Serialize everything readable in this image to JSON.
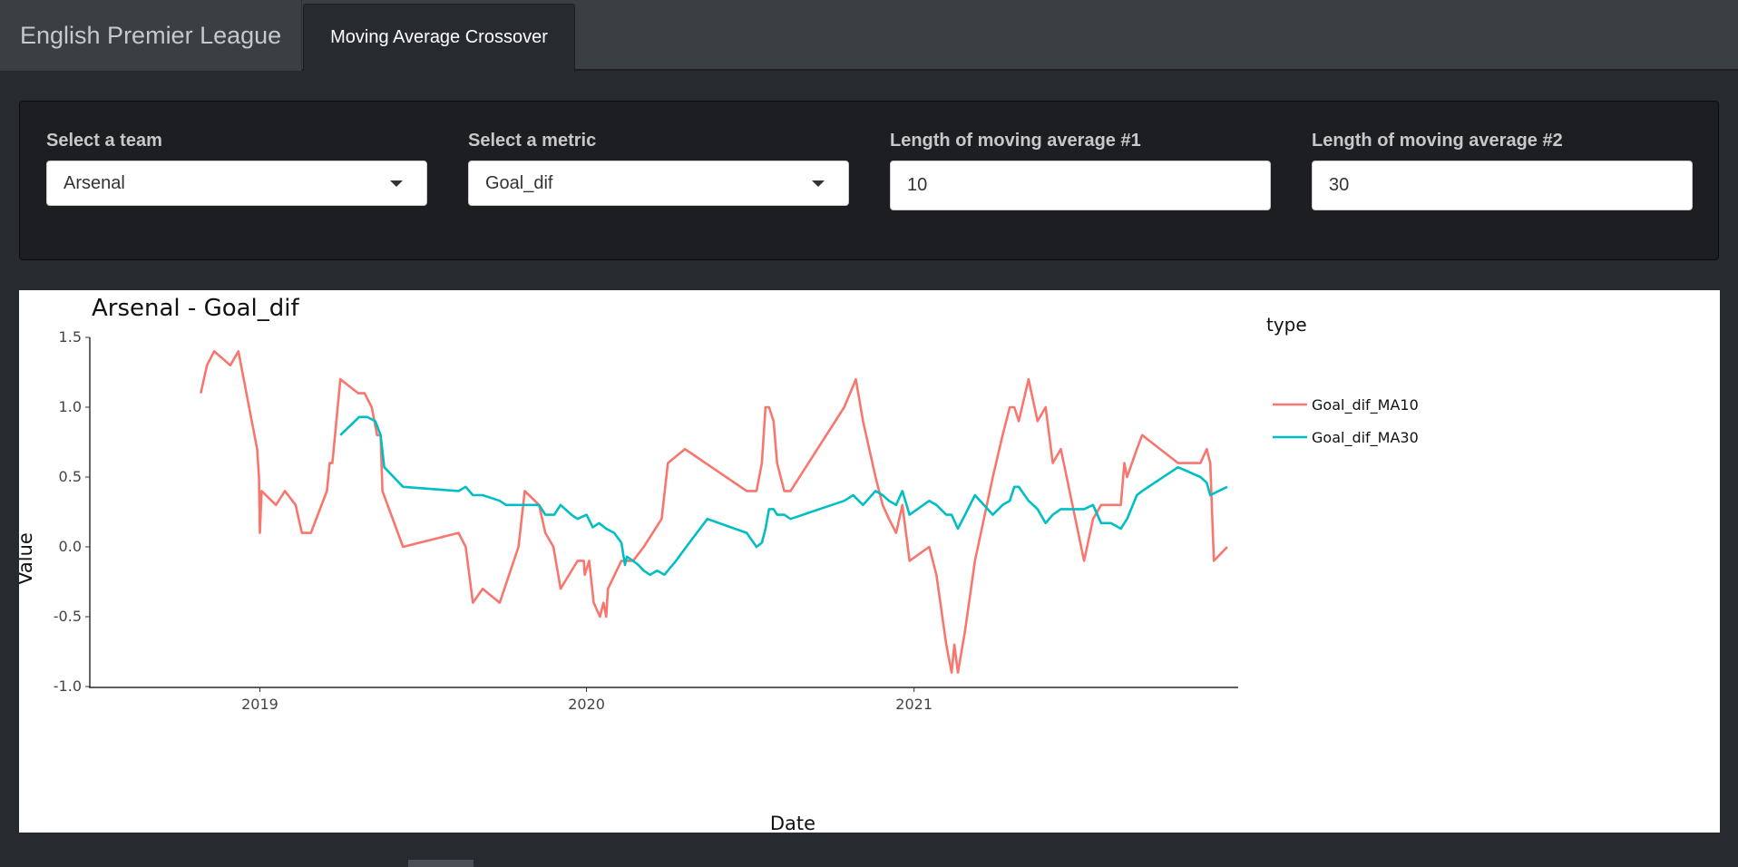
{
  "navbar": {
    "brand": "English Premier League",
    "tabs": [
      {
        "label": "Moving Average Crossover",
        "active": true
      }
    ]
  },
  "controls": {
    "team": {
      "label": "Select a team",
      "value": "Arsenal"
    },
    "metric": {
      "label": "Select a metric",
      "value": "Goal_dif"
    },
    "ma1": {
      "label": "Length of moving average #1",
      "value": "10"
    },
    "ma2": {
      "label": "Length of moving average #2",
      "value": "30"
    }
  },
  "chart_data": {
    "type": "line",
    "title": "Arsenal - Goal_dif",
    "xlabel": "Date",
    "ylabel": "Value",
    "legend_title": "type",
    "legend_position": "right",
    "grid": false,
    "xlim": [
      "2018-06-25",
      "2021-12-15"
    ],
    "ylim": [
      -1.0,
      1.5
    ],
    "x_ticks": [
      "2019-01-01",
      "2020-01-01",
      "2021-01-01"
    ],
    "x_tick_labels": [
      "2019",
      "2020",
      "2021"
    ],
    "y_ticks": [
      -1.0,
      -0.5,
      0.0,
      0.5,
      1.0,
      1.5
    ],
    "y_tick_labels": [
      "-1.0",
      "-0.5",
      "0.0",
      "0.5",
      "1.0",
      "1.5"
    ],
    "series": [
      {
        "name": "Goal_dif_MA10",
        "color": "#F8766D",
        "points": [
          [
            "2018-10-27",
            1.1
          ],
          [
            "2018-11-03",
            1.3
          ],
          [
            "2018-11-11",
            1.4
          ],
          [
            "2018-11-29",
            1.3
          ],
          [
            "2018-12-08",
            1.4
          ],
          [
            "2018-12-29",
            0.7
          ],
          [
            "2018-12-31",
            0.5
          ],
          [
            "2019-01-01",
            0.1
          ],
          [
            "2019-01-03",
            0.4
          ],
          [
            "2019-01-19",
            0.3
          ],
          [
            "2019-01-29",
            0.4
          ],
          [
            "2019-02-10",
            0.3
          ],
          [
            "2019-02-17",
            0.1
          ],
          [
            "2019-02-27",
            0.1
          ],
          [
            "2019-03-17",
            0.4
          ],
          [
            "2019-03-20",
            0.6
          ],
          [
            "2019-03-23",
            0.6
          ],
          [
            "2019-04-01",
            1.2
          ],
          [
            "2019-04-21",
            1.1
          ],
          [
            "2019-04-28",
            1.1
          ],
          [
            "2019-05-06",
            1.0
          ],
          [
            "2019-05-12",
            0.8
          ],
          [
            "2019-05-16",
            0.8
          ],
          [
            "2019-05-18",
            0.4
          ],
          [
            "2019-06-10",
            0.0
          ],
          [
            "2019-08-11",
            0.1
          ],
          [
            "2019-08-19",
            0.0
          ],
          [
            "2019-08-27",
            -0.4
          ],
          [
            "2019-09-07",
            -0.3
          ],
          [
            "2019-09-26",
            -0.4
          ],
          [
            "2019-10-17",
            0.0
          ],
          [
            "2019-10-24",
            0.4
          ],
          [
            "2019-11-09",
            0.3
          ],
          [
            "2019-11-16",
            0.1
          ],
          [
            "2019-11-25",
            0.0
          ],
          [
            "2019-12-03",
            -0.3
          ],
          [
            "2019-12-22",
            -0.1
          ],
          [
            "2019-12-29",
            -0.1
          ],
          [
            "2019-12-30",
            -0.2
          ],
          [
            "2020-01-04",
            -0.1
          ],
          [
            "2020-01-09",
            -0.4
          ],
          [
            "2020-01-16",
            -0.5
          ],
          [
            "2020-01-20",
            -0.4
          ],
          [
            "2020-01-23",
            -0.5
          ],
          [
            "2020-01-25",
            -0.3
          ],
          [
            "2020-02-09",
            -0.1
          ],
          [
            "2020-02-22",
            -0.1
          ],
          [
            "2020-03-05",
            0.0
          ],
          [
            "2020-03-25",
            0.2
          ],
          [
            "2020-04-01",
            0.6
          ],
          [
            "2020-04-20",
            0.7
          ],
          [
            "2020-06-28",
            0.4
          ],
          [
            "2020-07-09",
            0.4
          ],
          [
            "2020-07-15",
            0.6
          ],
          [
            "2020-07-19",
            1.0
          ],
          [
            "2020-07-23",
            1.0
          ],
          [
            "2020-07-28",
            0.9
          ],
          [
            "2020-08-01",
            0.6
          ],
          [
            "2020-08-09",
            0.4
          ],
          [
            "2020-08-16",
            0.4
          ],
          [
            "2020-10-15",
            1.0
          ],
          [
            "2020-10-28",
            1.2
          ],
          [
            "2020-11-05",
            0.9
          ],
          [
            "2020-11-19",
            0.5
          ],
          [
            "2020-11-27",
            0.3
          ],
          [
            "2020-12-04",
            0.2
          ],
          [
            "2020-12-12",
            0.1
          ],
          [
            "2020-12-19",
            0.3
          ],
          [
            "2020-12-27",
            -0.1
          ],
          [
            "2021-01-18",
            0.0
          ],
          [
            "2021-01-26",
            -0.2
          ],
          [
            "2021-02-06",
            -0.7
          ],
          [
            "2021-02-12",
            -0.9
          ],
          [
            "2021-02-15",
            -0.7
          ],
          [
            "2021-02-19",
            -0.9
          ],
          [
            "2021-02-27",
            -0.6
          ],
          [
            "2021-03-10",
            -0.1
          ],
          [
            "2021-03-30",
            0.5
          ],
          [
            "2021-04-10",
            0.8
          ],
          [
            "2021-04-18",
            1.0
          ],
          [
            "2021-04-23",
            1.0
          ],
          [
            "2021-04-28",
            0.9
          ],
          [
            "2021-05-09",
            1.2
          ],
          [
            "2021-05-19",
            0.9
          ],
          [
            "2021-05-28",
            1.0
          ],
          [
            "2021-06-05",
            0.6
          ],
          [
            "2021-06-14",
            0.7
          ],
          [
            "2021-07-10",
            -0.1
          ],
          [
            "2021-07-20",
            0.2
          ],
          [
            "2021-07-29",
            0.3
          ],
          [
            "2021-08-09",
            0.3
          ],
          [
            "2021-08-20",
            0.3
          ],
          [
            "2021-08-24",
            0.6
          ],
          [
            "2021-08-27",
            0.5
          ],
          [
            "2021-09-07",
            0.7
          ],
          [
            "2021-09-13",
            0.8
          ],
          [
            "2021-10-23",
            0.6
          ],
          [
            "2021-11-17",
            0.6
          ],
          [
            "2021-11-24",
            0.7
          ],
          [
            "2021-11-28",
            0.6
          ],
          [
            "2021-12-02",
            -0.1
          ],
          [
            "2021-12-17",
            0.0
          ]
        ]
      },
      {
        "name": "Goal_dif_MA30",
        "color": "#00BFC4",
        "points": [
          [
            "2019-04-01",
            0.8
          ],
          [
            "2019-04-22",
            0.93
          ],
          [
            "2019-05-01",
            0.93
          ],
          [
            "2019-05-10",
            0.9
          ],
          [
            "2019-05-16",
            0.8
          ],
          [
            "2019-05-20",
            0.57
          ],
          [
            "2019-06-10",
            0.43
          ],
          [
            "2019-08-11",
            0.4
          ],
          [
            "2019-08-19",
            0.43
          ],
          [
            "2019-08-27",
            0.37
          ],
          [
            "2019-09-07",
            0.37
          ],
          [
            "2019-09-26",
            0.33
          ],
          [
            "2019-10-03",
            0.3
          ],
          [
            "2019-10-24",
            0.3
          ],
          [
            "2019-11-09",
            0.3
          ],
          [
            "2019-11-16",
            0.23
          ],
          [
            "2019-11-26",
            0.23
          ],
          [
            "2019-12-03",
            0.3
          ],
          [
            "2019-12-15",
            0.23
          ],
          [
            "2019-12-22",
            0.2
          ],
          [
            "2020-01-01",
            0.23
          ],
          [
            "2020-01-08",
            0.14
          ],
          [
            "2020-01-15",
            0.17
          ],
          [
            "2020-01-23",
            0.13
          ],
          [
            "2020-02-01",
            0.1
          ],
          [
            "2020-02-09",
            0.03
          ],
          [
            "2020-02-13",
            -0.13
          ],
          [
            "2020-02-15",
            -0.07
          ],
          [
            "2020-02-22",
            -0.1
          ],
          [
            "2020-02-28",
            -0.13
          ],
          [
            "2020-03-05",
            -0.17
          ],
          [
            "2020-03-12",
            -0.2
          ],
          [
            "2020-03-20",
            -0.17
          ],
          [
            "2020-03-28",
            -0.2
          ],
          [
            "2020-04-10",
            -0.1
          ],
          [
            "2020-04-25",
            0.03
          ],
          [
            "2020-05-15",
            0.2
          ],
          [
            "2020-06-28",
            0.1
          ],
          [
            "2020-07-09",
            0.0
          ],
          [
            "2020-07-15",
            0.03
          ],
          [
            "2020-07-19",
            0.13
          ],
          [
            "2020-07-23",
            0.27
          ],
          [
            "2020-07-28",
            0.27
          ],
          [
            "2020-08-01",
            0.23
          ],
          [
            "2020-08-09",
            0.23
          ],
          [
            "2020-08-16",
            0.2
          ],
          [
            "2020-10-15",
            0.33
          ],
          [
            "2020-10-25",
            0.37
          ],
          [
            "2020-11-05",
            0.3
          ],
          [
            "2020-11-19",
            0.4
          ],
          [
            "2020-11-27",
            0.37
          ],
          [
            "2020-12-04",
            0.33
          ],
          [
            "2020-12-12",
            0.3
          ],
          [
            "2020-12-19",
            0.4
          ],
          [
            "2020-12-27",
            0.23
          ],
          [
            "2021-01-18",
            0.33
          ],
          [
            "2021-01-26",
            0.3
          ],
          [
            "2021-02-06",
            0.23
          ],
          [
            "2021-02-12",
            0.23
          ],
          [
            "2021-02-19",
            0.13
          ],
          [
            "2021-02-27",
            0.23
          ],
          [
            "2021-03-10",
            0.37
          ],
          [
            "2021-03-30",
            0.23
          ],
          [
            "2021-04-10",
            0.3
          ],
          [
            "2021-04-18",
            0.33
          ],
          [
            "2021-04-23",
            0.43
          ],
          [
            "2021-04-28",
            0.43
          ],
          [
            "2021-05-09",
            0.33
          ],
          [
            "2021-05-19",
            0.27
          ],
          [
            "2021-05-28",
            0.17
          ],
          [
            "2021-06-05",
            0.23
          ],
          [
            "2021-06-14",
            0.27
          ],
          [
            "2021-07-10",
            0.27
          ],
          [
            "2021-07-20",
            0.3
          ],
          [
            "2021-07-29",
            0.17
          ],
          [
            "2021-08-09",
            0.17
          ],
          [
            "2021-08-20",
            0.13
          ],
          [
            "2021-08-24",
            0.17
          ],
          [
            "2021-08-27",
            0.2
          ],
          [
            "2021-09-07",
            0.37
          ],
          [
            "2021-09-13",
            0.4
          ],
          [
            "2021-10-23",
            0.57
          ],
          [
            "2021-11-17",
            0.5
          ],
          [
            "2021-11-24",
            0.46
          ],
          [
            "2021-11-28",
            0.37
          ],
          [
            "2021-12-17",
            0.43
          ]
        ]
      }
    ]
  }
}
